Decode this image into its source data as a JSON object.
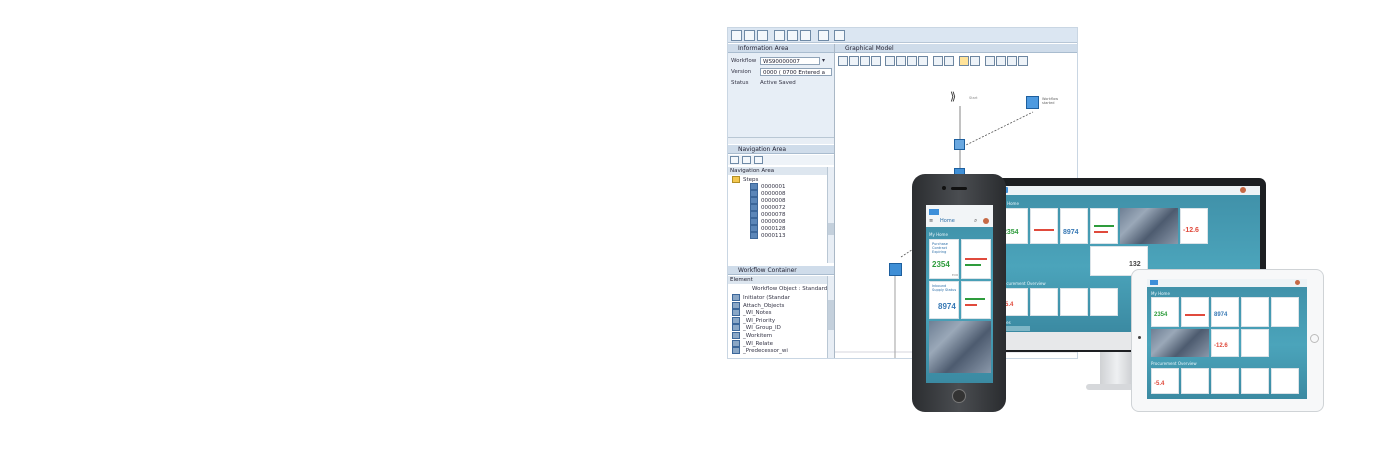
{
  "gui": {
    "info_area_title": "Information Area",
    "workflow_label": "Workflow",
    "workflow_value": "WS90000007",
    "version_label": "Version",
    "version_value": "0000 ( 0700 Entered a",
    "status_label": "Status",
    "status_value": "Active Saved",
    "nav_area_title": "Navigation Area",
    "nav_tree_header": "Navigation Area",
    "steps_folder": "Steps",
    "steps": [
      "0000001",
      "0000008",
      "0000008",
      "0000072",
      "0000078",
      "0000008",
      "0000128",
      "0000113"
    ],
    "container_title": "Workflow Container",
    "container_header": "Element",
    "container_col": "Workflow Object : Standard",
    "container_items": [
      "Initiator (Standar",
      "Attach_Objects",
      "_WI_Notes",
      "_WI_Priority",
      "_WI_Group_ID",
      "_Workitem",
      "_WI_Relate",
      "_Predecessor_wi"
    ],
    "graph_title": "Graphical Model",
    "start_label": "Start",
    "event_label": "Workflow started"
  },
  "phone": {
    "title": "Home",
    "section": "My Home",
    "tile1_title": "Purchase Contract Expiring",
    "tile1_value": "2354",
    "tile1_unit": "EUR",
    "tile2_value": "8974",
    "tile2_title": "Inbound Supply Status"
  },
  "monitor": {
    "section1": "My Home",
    "section2": "Procurement Overview",
    "section3": "Sales",
    "value1": "2354",
    "value2": "8974",
    "value3": "-12.6",
    "value4": "132",
    "value5": "-5.4"
  },
  "tablet": {
    "section1": "My Home",
    "section2": "Procurement Overview",
    "value1": "2354",
    "value2": "8974",
    "value3": "-12.6",
    "value4": "-5.4"
  },
  "colors": {
    "fiori_teal": "#3f8fa7",
    "sap_blue": "#3f8fd6",
    "gui_panel": "#cfdcea",
    "kpi_green": "#2e9c3c",
    "kpi_red": "#e04a3c",
    "kpi_blue": "#3879b5"
  },
  "icons": [
    "create-icon",
    "open-icon",
    "save-icon",
    "check-icon",
    "activate-icon",
    "test-icon",
    "event-icon",
    "workflow-start-icon",
    "step-icon",
    "container-icon"
  ]
}
